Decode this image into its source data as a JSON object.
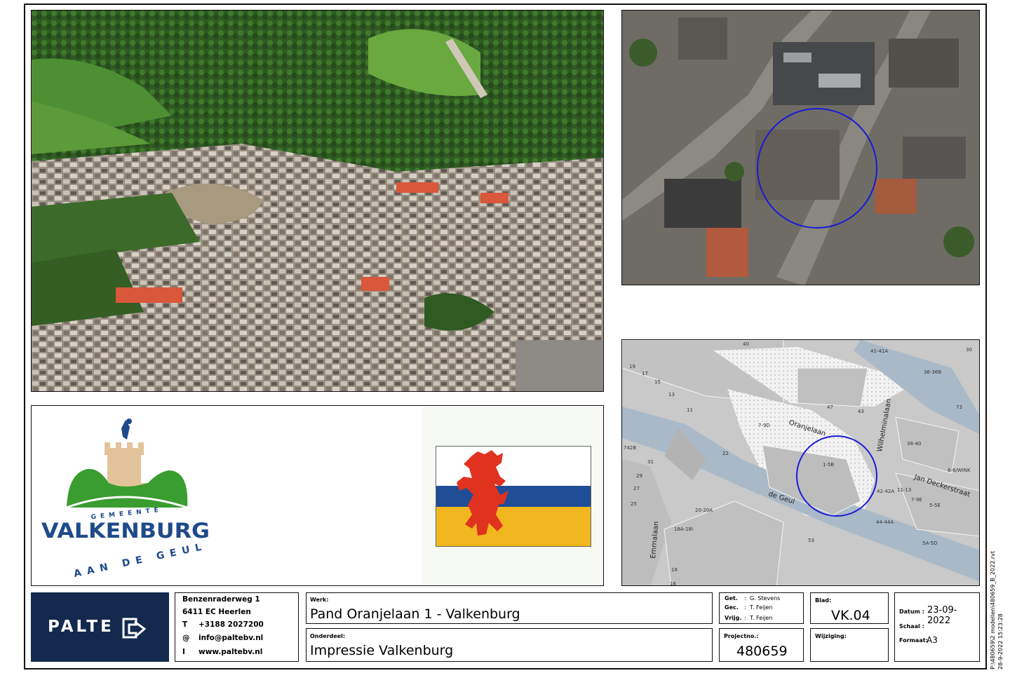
{
  "aerial_photo": {
    "description": ""
  },
  "satellite_photo": {
    "description": ""
  },
  "cadastral_map": {
    "labels": {
      "oranjelaan": "Oranjelaan",
      "wilhelminalaan": "Wilhelminalaan",
      "jan_deckerstraat": "Jan Deckerstraat",
      "de_geul": "de Geul",
      "emmalaan": "Emmalaan",
      "n_1_5b": "1-5B",
      "n_47": "47",
      "n_43": "43",
      "n_7_9d": "7-9D",
      "n_22": "22",
      "n_38_40": "38-40",
      "n_6_6winkel": "6-6/WINK",
      "n_42_42a": "42-42A",
      "n_11_13": "11-13",
      "n_7_9e": "7-9E",
      "n_5_5e": "5-5E",
      "n_44_44a": "44-44A",
      "n_5a_5d": "5A-5D",
      "n_20_20a": "20-20A",
      "n_18a_18i": "18A-18I",
      "n_53": "53",
      "n_41_41a": "41-41A",
      "n_36_36b": "36-36B",
      "n_73": "73",
      "n_19": "19",
      "n_17": "17",
      "n_15": "15",
      "n_13": "13",
      "n_11": "11",
      "n_31": "31",
      "n_29": "29",
      "n_27": "27",
      "n_25": "25",
      "n_18": "18",
      "n_16": "16",
      "n_742b": "742B",
      "n_30": "30",
      "n_40": "40"
    }
  },
  "municipality_logo": {
    "line_top": "GEMEENTE",
    "line_main": "VALKENBURG",
    "line_bottom": "AAN DE GEUL"
  },
  "limburg_flag": {
    "colors": {
      "white": "#ffffff",
      "blue": "#1f4e96",
      "yellow": "#f2b71e",
      "lion": "#e0321e"
    }
  },
  "title_block": {
    "company_logo": "PALTE",
    "address_line1": "Benzenraderweg 1",
    "address_line2": "6411 EC  Heerlen",
    "phone_prefix": "T",
    "phone": "+3188 2027200",
    "email_prefix": "@",
    "email": "info@paltebv.nl",
    "web_prefix": "I",
    "web": "www.paltebv.nl",
    "werk_label": "Werk:",
    "werk_value": "Pand Oranjelaan 1 - Valkenburg",
    "onderdeel_label": "Onderdeel:",
    "onderdeel_value": "Impressie Valkenburg",
    "get_label": "Get.",
    "get_value": "G. Stevens",
    "gec_label": "Gec.",
    "gec_value": "T. Feijen",
    "vrijg_label": "Vrijg.",
    "vrijg_value": "T. Feijen",
    "sep": ":",
    "projectno_label": "Projectno.:",
    "projectno_value": "480659",
    "blad_label": "Blad:",
    "blad_value": "VK.04",
    "wijziging_label": "Wijziging:",
    "datum_label": "Datum :",
    "datum_value": "23-09-2022",
    "schaal_label": "Schaal :",
    "formaat_label": "Formaat:",
    "formaat_value": "A3"
  },
  "side_text": {
    "line1": "P:\\480659\\2 modellen\\480659_B_2022.rvt",
    "line2": "28-9-2022 15:23:28"
  },
  "colors": {
    "palte_navy": "#132a4e",
    "marker_blue": "#1a1ad8",
    "logo_green": "#3a9d2f",
    "logo_tan": "#e3c39a",
    "logo_blue": "#1f4a8a"
  }
}
